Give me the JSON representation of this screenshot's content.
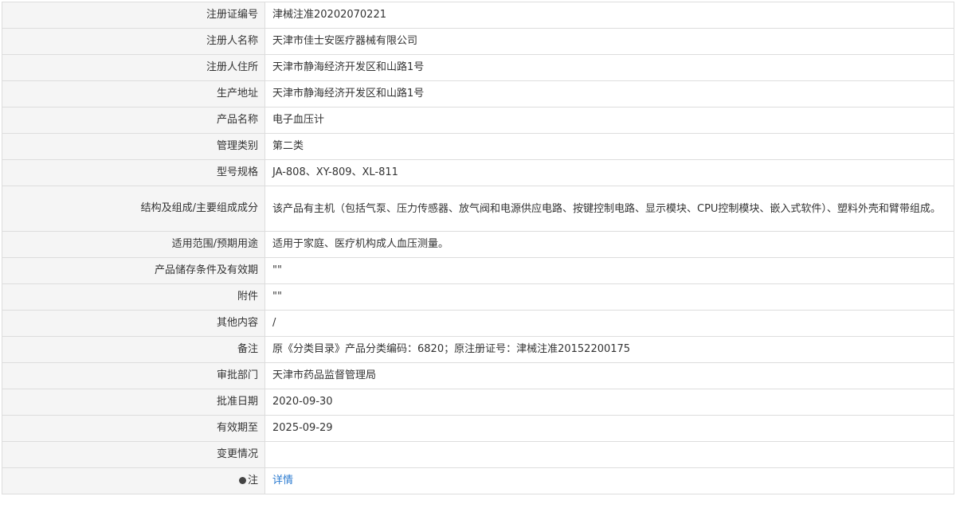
{
  "rows": [
    {
      "label": "注册证编号",
      "value": "津械注准20202070221"
    },
    {
      "label": "注册人名称",
      "value": "天津市佳士安医疗器械有限公司"
    },
    {
      "label": "注册人住所",
      "value": "天津市静海经济开发区和山路1号"
    },
    {
      "label": "生产地址",
      "value": "天津市静海经济开发区和山路1号"
    },
    {
      "label": "产品名称",
      "value": "电子血压计"
    },
    {
      "label": "管理类别",
      "value": "第二类"
    },
    {
      "label": "型号规格",
      "value": "JA-808、XY-809、XL-811"
    },
    {
      "label": "结构及组成/主要组成成分",
      "value": "该产品有主机（包括气泵、压力传感器、放气阀和电源供应电路、按键控制电路、显示模块、CPU控制模块、嵌入式软件）、塑料外壳和臂带组成。"
    },
    {
      "label": "适用范围/预期用途",
      "value": "适用于家庭、医疗机构成人血压测量。"
    },
    {
      "label": "产品储存条件及有效期",
      "value": "\"\""
    },
    {
      "label": "附件",
      "value": "\"\""
    },
    {
      "label": "其他内容",
      "value": "/"
    },
    {
      "label": "备注",
      "value": "原《分类目录》产品分类编码：6820；原注册证号：津械注准20152200175"
    },
    {
      "label": "审批部门",
      "value": "天津市药品监督管理局"
    },
    {
      "label": "批准日期",
      "value": "2020-09-30"
    },
    {
      "label": "有效期至",
      "value": "2025-09-29"
    },
    {
      "label": "变更情况",
      "value": ""
    }
  ],
  "note": {
    "icon": "bulb-icon",
    "label": "注",
    "link_text": "详情"
  },
  "colors": {
    "border": "#dddddd",
    "label_bg": "#f5f5f5",
    "link": "#2b7bd0"
  }
}
